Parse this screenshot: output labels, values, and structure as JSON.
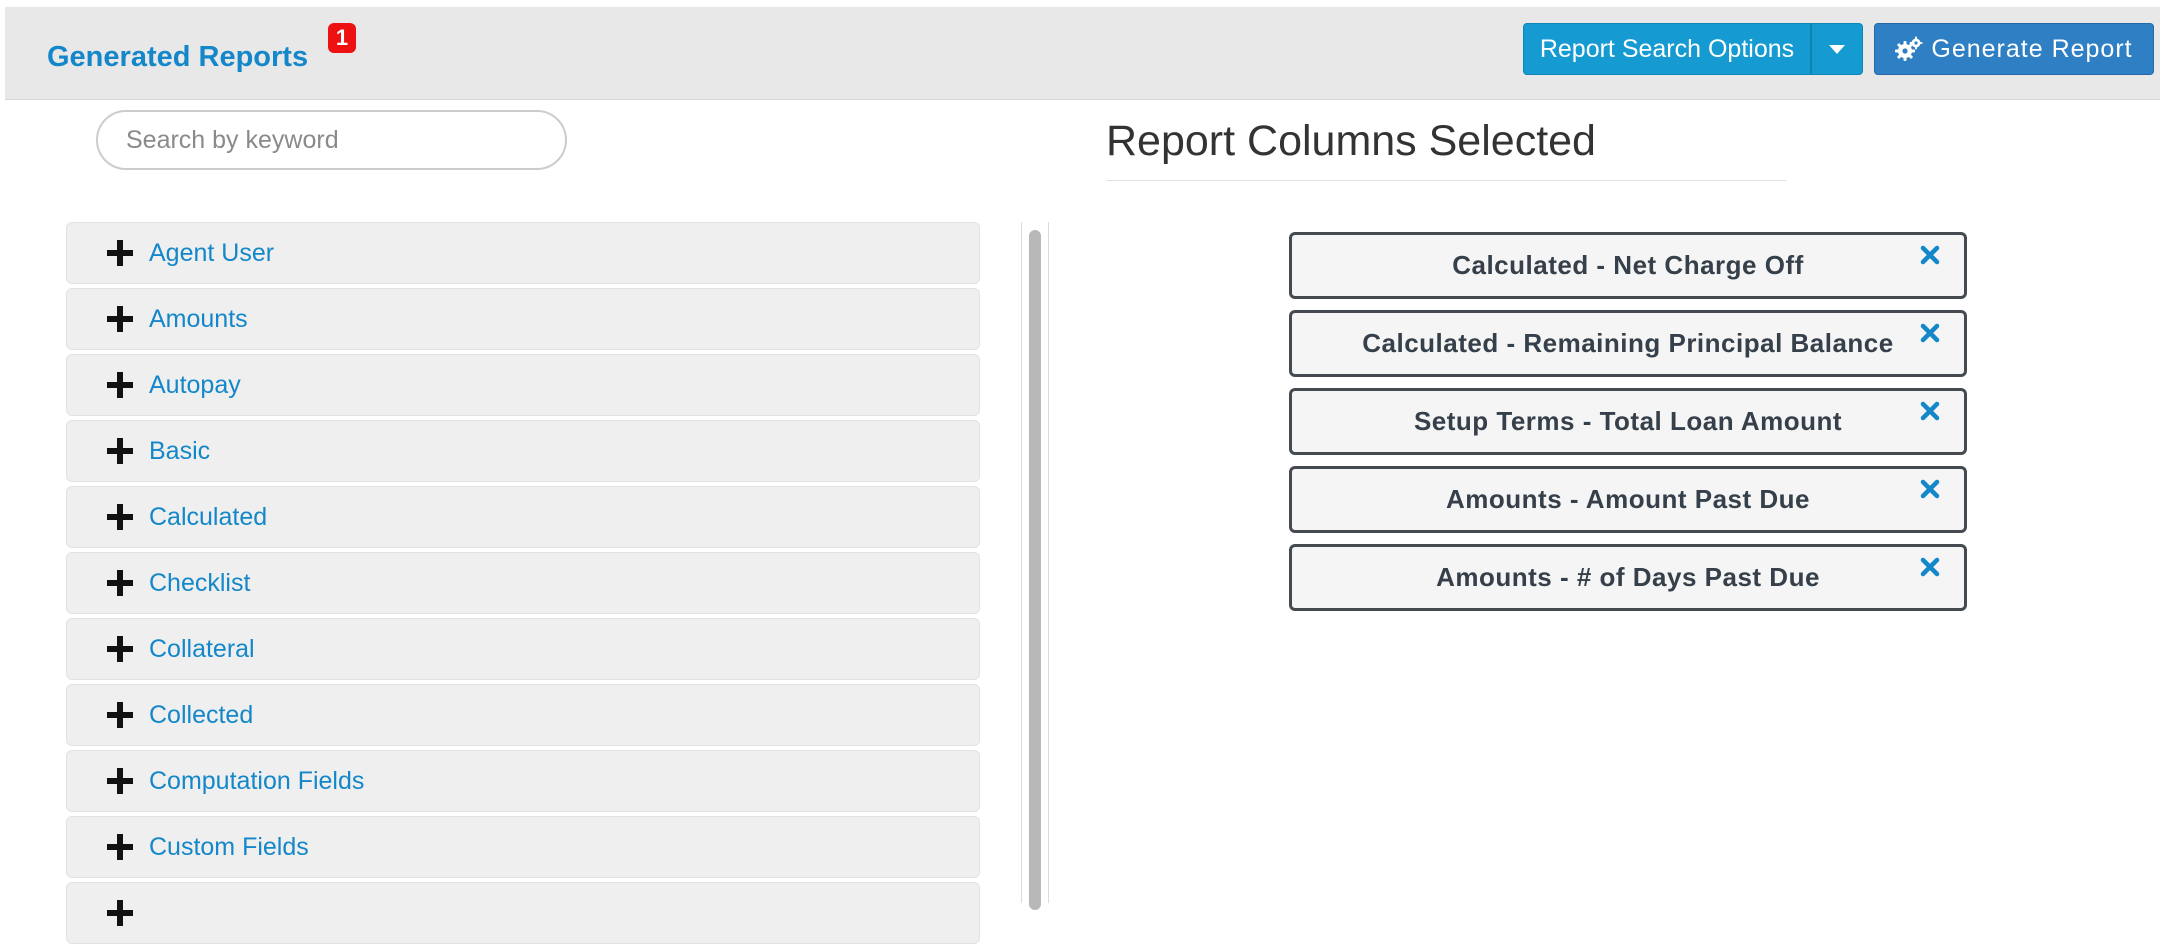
{
  "header": {
    "title": "Generated Reports",
    "badge_count": "1",
    "search_options_label": "Report Search Options",
    "generate_label": "Generate Report"
  },
  "search": {
    "placeholder": "Search by keyword",
    "value": ""
  },
  "categories": [
    {
      "label": "Agent User"
    },
    {
      "label": "Amounts"
    },
    {
      "label": "Autopay"
    },
    {
      "label": "Basic"
    },
    {
      "label": "Calculated"
    },
    {
      "label": "Checklist"
    },
    {
      "label": "Collateral"
    },
    {
      "label": "Collected"
    },
    {
      "label": "Computation Fields"
    },
    {
      "label": "Custom Fields"
    }
  ],
  "selected": {
    "title": "Report Columns Selected",
    "columns": [
      {
        "label": "Calculated - Net Charge Off"
      },
      {
        "label": "Calculated - Remaining Principal Balance"
      },
      {
        "label": "Setup Terms - Total Loan Amount"
      },
      {
        "label": "Amounts - Amount Past Due"
      },
      {
        "label": "Amounts - # of Days Past Due"
      }
    ]
  },
  "icons": {
    "expand": "plus-icon",
    "remove": "close-icon",
    "dropdown": "caret-down-icon",
    "generate": "gears-icon"
  },
  "colors": {
    "link": "#1387c9",
    "primary_button": "#159bd2",
    "generate_button": "#2f7fc4",
    "badge": "#ee1111"
  }
}
